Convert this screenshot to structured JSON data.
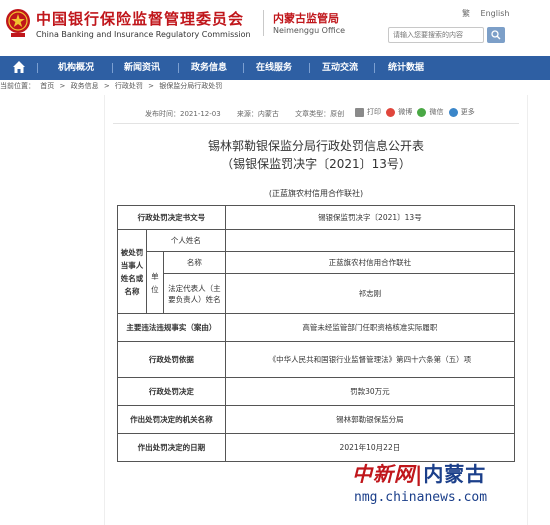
{
  "header": {
    "title_cn": "中国银行保险监督管理委员会",
    "title_en": "China Banking and Insurance Regulatory Commission",
    "branch_cn": "内蒙古监管局",
    "branch_en": "Neimenggu Office",
    "top_links": [
      "繁",
      "English"
    ],
    "search_placeholder": "请输入您要搜索的内容"
  },
  "nav": {
    "items": [
      "机构概况",
      "新闻资讯",
      "政务信息",
      "在线服务",
      "互动交流",
      "统计数据"
    ]
  },
  "breadcrumb": {
    "prefix": "当前位置：",
    "items": [
      "首页",
      ">",
      "政务信息",
      ">",
      "行政处罚",
      ">",
      "银保监分局行政处罚"
    ]
  },
  "article": {
    "meta": [
      "发布时间：2021-12-03",
      "来源：内蒙古",
      "文章类型：原创"
    ],
    "tools": [
      "打印",
      "微博",
      "微信",
      "更多"
    ],
    "title_line1": "锡林郭勒银保监分局行政处罚信息公开表",
    "title_line2": "（锡银保监罚决字〔2021〕13号）",
    "org_line": "(正蓝旗农村信用合作联社)"
  },
  "table": {
    "decision_no_label": "行政处罚决定书文号",
    "decision_no": "锡银保监罚决字〔2021〕13号",
    "party_label": "被处罚当事人姓名或名称",
    "individual_label": "个人姓名",
    "individual_value": "",
    "unit_label": "单位",
    "name_label": "名称",
    "name_value": "正蓝旗农村信用合作联社",
    "rep_label": "法定代表人（主要负责人）姓名",
    "rep_value": "祁志刚",
    "facts_label": "主要违法违规事实（案由）",
    "facts_value": "高管未经监管部门任职资格核准实际履职",
    "basis_label": "行政处罚依据",
    "basis_value": "《中华人民共和国银行业监督管理法》第四十六条第（五）项",
    "decision_label": "行政处罚决定",
    "decision_value": "罚款30万元",
    "authority_label": "作出处罚决定的机关名称",
    "authority_value": "锡林郭勒银保监分局",
    "date_label": "作出处罚决定的日期",
    "date_value": "2021年10月22日"
  },
  "watermark": {
    "cn_left": "中新网",
    "cn_sep": "|",
    "cn_right": "内蒙古",
    "url": "nmg.chinanews.com"
  },
  "colors": {
    "brand_red": "#c0161b",
    "nav_blue": "#2e5fa3",
    "watermark_blue": "#1b3f8a"
  },
  "icons": [
    "emblem-icon",
    "home-icon",
    "search-icon",
    "print-icon",
    "weibo-icon",
    "wechat-icon",
    "more-icon"
  ]
}
